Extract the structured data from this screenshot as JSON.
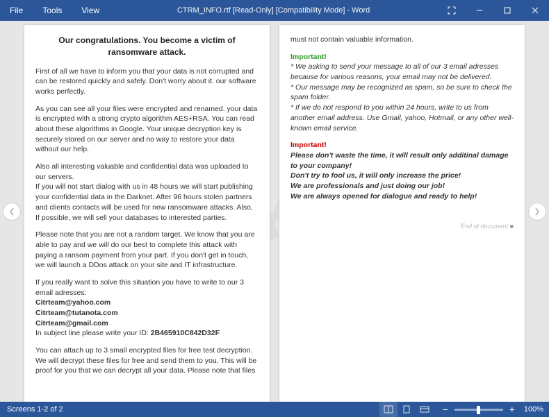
{
  "titlebar": {
    "menu": {
      "file": "File",
      "tools": "Tools",
      "view": "View"
    },
    "title": "CTRM_INFO.rtf [Read-Only] [Compatibility Mode] - Word"
  },
  "doc": {
    "heading": "Our congratulations. You become a victim of ransomware attack.",
    "p1": "First of all we have to inform you that your data is not corrupted and can be restored quickly and safely. Don't worry about it. our software works perfectly.",
    "p2": "As you can see all your files were encrypted and renamed. your data is encrypted with a strong crypto algorithm AES+RSA. You can read about these algorithms in Google. Your unique decryption key is securely stored on our server and no way to restore your data without our help.",
    "p3a": "Also all interesting valuable and confidential data was uploaded to our servers.",
    "p3b": "If you will not start dialog with us in 48 hours we will start publishing your confidential data in the Darknet. After 96 hours stolen partners and clients contacts will be used for new ransomware attacks. Also, If possible, we will sell your databases to interested parties.",
    "p4": "Please note that you are not a random target. We know that you are able to pay and we will do our best to complete this attack with paying a ransom payment from your part. If you don't get in touch, we will launch a DDos attack on your site and IT infrastructure.",
    "p5": "If you really want to solve this situation you have to write to our 3 email adresses:",
    "emails": [
      "Citrteam@yahoo.com",
      "Citrteam@tutanota.com",
      "Citrteam@gmail.com"
    ],
    "id_label": "In subject line please write your ID: ",
    "id_value": "2B465910C842D32F",
    "p6": "You can attach up to 3 small encrypted files for free test decryption. We will decrypt these files for free and send them to you. This will be proof for you that we can decrypt all your data. Please note that files",
    "p6cont": "must not contain valuable information.",
    "imp1_label": "Important!",
    "imp1_a": "* We asking to send your message to all of our 3 email adresses because for various reasons, your email may not be delivered.",
    "imp1_b": "* Our message may be recognized as spam, so be sure to check the spam folder.",
    "imp1_c": "* If we do not respond to you within 24 hours, write to us from another email address. Use Gmail, yahoo, Hotmail, or any other well-known email service.",
    "imp2_label": "Important!",
    "imp2_a": "Please don't waste the time, it will result only additinal damage to your company!",
    "imp2_b": "Don't try to fool us, it will only increase the price!",
    "imp2_c": "We are professionals and just doing our job!",
    "imp2_d": "We are always opened for dialogue and ready to help!",
    "eod": "End of document"
  },
  "statusbar": {
    "screens": "Screens 1-2 of 2",
    "zoom": "100%"
  },
  "watermark": "pcrisk.com"
}
